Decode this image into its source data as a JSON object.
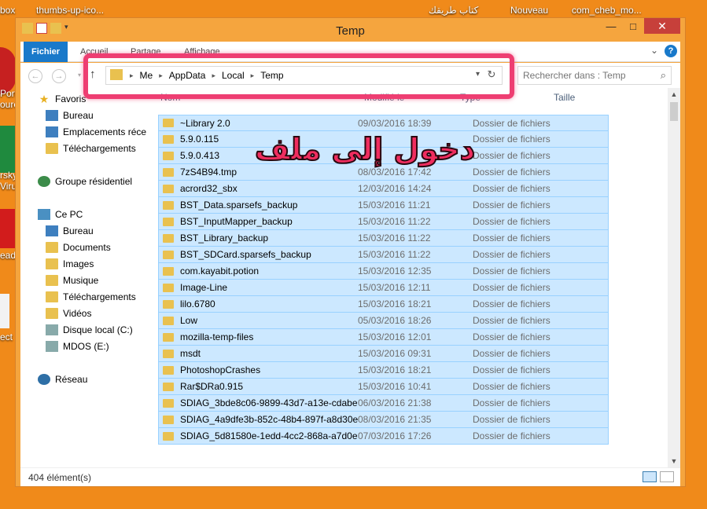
{
  "desktop": {
    "icons": [
      "box",
      "thumbs-up-ico...",
      "كتاب طريقك",
      "Nouveau",
      "com_cheb_mo..."
    ],
    "left_labels": [
      "Port",
      "ourc",
      "rsky",
      "Virus",
      "eade",
      "ect"
    ]
  },
  "window": {
    "title": "Temp",
    "controls": {
      "minimize": "—",
      "maximize": "□",
      "close": "✕"
    }
  },
  "ribbon": {
    "tabs": [
      "Fichier",
      "Accueil",
      "Partage",
      "Affichage"
    ],
    "expand": "⌄",
    "help": "?"
  },
  "address": {
    "breadcrumbs": [
      "Me",
      "AppData",
      "Local",
      "Temp"
    ],
    "search_placeholder": "Rechercher dans : Temp"
  },
  "sidebar": {
    "favorites": {
      "label": "Favoris",
      "items": [
        "Bureau",
        "Emplacements récer",
        "Téléchargements"
      ]
    },
    "homegroup": "Groupe résidentiel",
    "pc": {
      "label": "Ce PC",
      "items": [
        "Bureau",
        "Documents",
        "Images",
        "Musique",
        "Téléchargements",
        "Vidéos",
        "Disque local (C:)",
        "MDOS (E:)"
      ]
    },
    "network": "Réseau"
  },
  "columns": [
    "Nom",
    "Modifié le",
    "Type",
    "Taille"
  ],
  "files": [
    {
      "name": "~Library 2.0",
      "date": "09/03/2016 18:39",
      "type": "Dossier de fichiers"
    },
    {
      "name": "5.9.0.115",
      "date": "",
      "type": "Dossier de fichiers"
    },
    {
      "name": "5.9.0.413",
      "date": "",
      "type": "Dossier de fichiers"
    },
    {
      "name": "7zS4B94.tmp",
      "date": "08/03/2016 17:42",
      "type": "Dossier de fichiers"
    },
    {
      "name": "acrord32_sbx",
      "date": "12/03/2016 14:24",
      "type": "Dossier de fichiers"
    },
    {
      "name": "BST_Data.sparsefs_backup",
      "date": "15/03/2016 11:21",
      "type": "Dossier de fichiers"
    },
    {
      "name": "BST_InputMapper_backup",
      "date": "15/03/2016 11:22",
      "type": "Dossier de fichiers"
    },
    {
      "name": "BST_Library_backup",
      "date": "15/03/2016 11:22",
      "type": "Dossier de fichiers"
    },
    {
      "name": "BST_SDCard.sparsefs_backup",
      "date": "15/03/2016 11:22",
      "type": "Dossier de fichiers"
    },
    {
      "name": "com.kayabit.potion",
      "date": "15/03/2016 12:35",
      "type": "Dossier de fichiers"
    },
    {
      "name": "Image-Line",
      "date": "15/03/2016 12:11",
      "type": "Dossier de fichiers"
    },
    {
      "name": "lilo.6780",
      "date": "15/03/2016 18:21",
      "type": "Dossier de fichiers"
    },
    {
      "name": "Low",
      "date": "05/03/2016 18:26",
      "type": "Dossier de fichiers"
    },
    {
      "name": "mozilla-temp-files",
      "date": "15/03/2016 12:01",
      "type": "Dossier de fichiers"
    },
    {
      "name": "msdt",
      "date": "15/03/2016 09:31",
      "type": "Dossier de fichiers"
    },
    {
      "name": "PhotoshopCrashes",
      "date": "15/03/2016 18:21",
      "type": "Dossier de fichiers"
    },
    {
      "name": "Rar$DRa0.915",
      "date": "15/03/2016 10:41",
      "type": "Dossier de fichiers"
    },
    {
      "name": "SDIAG_3bde8c06-9899-43d7-a13e-cdabe...",
      "date": "06/03/2016 21:38",
      "type": "Dossier de fichiers"
    },
    {
      "name": "SDIAG_4a9dfe3b-852c-48b4-897f-a8d30e...",
      "date": "08/03/2016 21:35",
      "type": "Dossier de fichiers"
    },
    {
      "name": "SDIAG_5d81580e-1edd-4cc2-868a-a7d0e...",
      "date": "07/03/2016 17:26",
      "type": "Dossier de fichiers"
    }
  ],
  "overlay_text": "دخول إلى ملف",
  "status": {
    "count": "404 élément(s)"
  },
  "colors": {
    "accent": "#1979ca",
    "annotation": "#ee3e72",
    "selection": "#cce8ff",
    "desktop": "#f08a1a"
  }
}
